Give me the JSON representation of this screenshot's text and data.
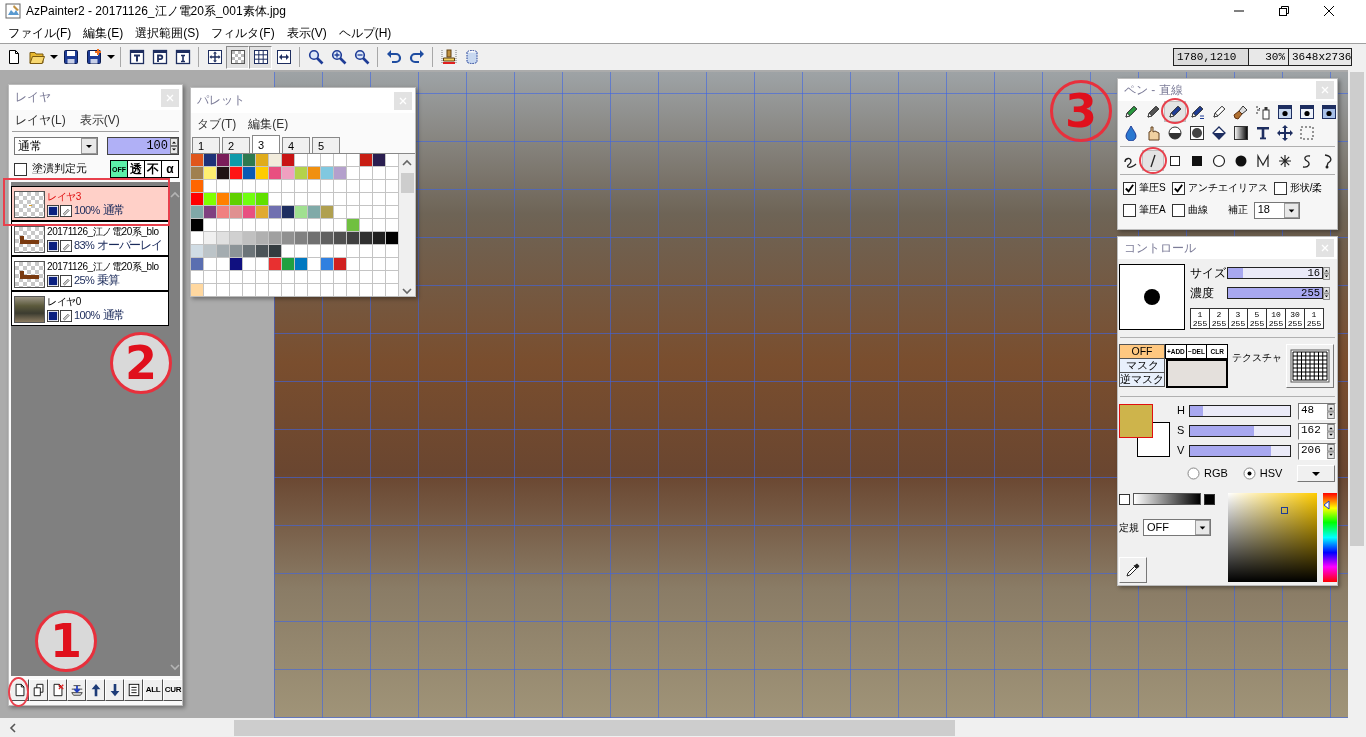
{
  "window": {
    "title": "AzPainter2 - 20171126_江ノ電20系_001素体.jpg"
  },
  "menu": [
    "ファイル(F)",
    "編集(E)",
    "選択範囲(S)",
    "フィルタ(F)",
    "表示(V)",
    "ヘルプ(H)"
  ],
  "toolbar": [
    {
      "pressed": false
    },
    {
      "pressed": false
    },
    {
      "pressed": false
    },
    {
      "pressed": false
    },
    {
      "pressed": false
    },
    {
      "pressed": false
    },
    {
      "pressed": false
    },
    {
      "pressed": false
    },
    {
      "pressed": false
    },
    {
      "pressed": false
    },
    {
      "pressed": true
    },
    {
      "pressed": true
    },
    {
      "pressed": false
    },
    {
      "pressed": false
    },
    {
      "pressed": false
    },
    {
      "pressed": false
    },
    {
      "pressed": false
    },
    {
      "pressed": false
    },
    {
      "pressed": false
    },
    {
      "pressed": false
    }
  ],
  "status": [
    "1780,1210",
    "30%",
    "3648x2736"
  ],
  "layer_panel": {
    "title": "レイヤ",
    "menu": [
      "レイヤ(L)",
      "表示(V)"
    ],
    "blend_mode": "通常",
    "opacity": "100",
    "fill_source": {
      "label": "塗潰判定元",
      "checked": false
    },
    "mode_buttons": [
      {
        "label": "OFF",
        "selected": true
      },
      {
        "label": "透",
        "selected": false
      },
      {
        "label": "不",
        "selected": false
      },
      {
        "label": "α",
        "selected": false
      }
    ],
    "layers": [
      {
        "name": "レイヤ3",
        "opacity": "100%",
        "mode": "通常",
        "kind": "empty",
        "visible": true,
        "selected": true
      },
      {
        "name": "20171126_江ノ電20系_blo",
        "opacity": "83%",
        "mode": "オーバーレイ",
        "kind": "drawing",
        "visible": true,
        "selected": false
      },
      {
        "name": "20171126_江ノ電20系_blo",
        "opacity": "25%",
        "mode": "乗算",
        "kind": "drawing",
        "visible": true,
        "selected": false
      },
      {
        "name": "レイヤ0",
        "opacity": "100%",
        "mode": "通常",
        "kind": "photo",
        "visible": true,
        "selected": false
      }
    ],
    "footer_buttons": [
      "ALL",
      "CUR"
    ]
  },
  "palette_panel": {
    "title": "パレット",
    "menu": [
      "タブ(T)",
      "編集(E)"
    ],
    "tabs": [
      {
        "label": "1",
        "selected": false
      },
      {
        "label": "2",
        "selected": false
      },
      {
        "label": "3",
        "selected": true
      },
      {
        "label": "4",
        "selected": false
      },
      {
        "label": "5",
        "selected": false
      }
    ],
    "rows": [
      {
        "swatches": [
          {
            "color": "#e0561c"
          },
          {
            "color": "#1e3278"
          },
          {
            "color": "#7a1e5a"
          },
          {
            "color": "#0e9aaa"
          },
          {
            "color": "#2e7a50"
          },
          {
            "color": "#e0ac1c"
          },
          {
            "color": "#f2ecdc"
          },
          {
            "color": "#c81414"
          },
          {
            "color": "#ffffff"
          },
          {
            "color": "#ffffff"
          },
          {
            "color": "#ffffff"
          },
          {
            "color": "#ffffff"
          },
          {
            "color": "#ffffff"
          },
          {
            "color": "#c81e14"
          },
          {
            "color": "#2a1e50"
          },
          {
            "color": "#ffffff"
          }
        ]
      },
      {
        "swatches": [
          {
            "color": "#a08050"
          },
          {
            "color": "#fff070"
          },
          {
            "color": "#201414"
          },
          {
            "color": "#ff1414"
          },
          {
            "color": "#0a5ab4"
          },
          {
            "color": "#ffcc00"
          },
          {
            "color": "#e85080"
          },
          {
            "color": "#f0a0c0"
          },
          {
            "color": "#b4d24a"
          },
          {
            "color": "#f09010"
          },
          {
            "color": "#80c8e0"
          },
          {
            "color": "#b4a0cc"
          },
          {
            "color": "#ffffff"
          },
          {
            "color": "#ffffff"
          },
          {
            "color": "#ffffff"
          },
          {
            "color": "#ffffff"
          }
        ]
      },
      {
        "swatches": [
          {
            "color": "#ff6600"
          },
          {
            "color": "#ffffff"
          },
          {
            "color": "#ffffff"
          },
          {
            "color": "#ffffff"
          },
          {
            "color": "#ffffff"
          },
          {
            "color": "#ffffff"
          },
          {
            "color": "#ffffff"
          },
          {
            "color": "#ffffff"
          },
          {
            "color": "#ffffff"
          },
          {
            "color": "#ffffff"
          },
          {
            "color": "#ffffff"
          },
          {
            "color": "#ffffff"
          },
          {
            "color": "#ffffff"
          },
          {
            "color": "#ffffff"
          },
          {
            "color": "#ffffff"
          },
          {
            "color": "#ffffff"
          }
        ]
      },
      {
        "swatches": [
          {
            "color": "#ff0000"
          },
          {
            "color": "#80ff00"
          },
          {
            "color": "#ff8000"
          },
          {
            "color": "#60d000"
          },
          {
            "color": "#70ff10"
          },
          {
            "color": "#60e000"
          },
          {
            "color": "#ffffff"
          },
          {
            "color": "#ffffff"
          },
          {
            "color": "#ffffff"
          },
          {
            "color": "#ffffff"
          },
          {
            "color": "#ffffff"
          },
          {
            "color": "#ffffff"
          },
          {
            "color": "#ffffff"
          },
          {
            "color": "#ffffff"
          },
          {
            "color": "#ffffff"
          },
          {
            "color": "#ffffff"
          }
        ]
      },
      {
        "swatches": [
          {
            "color": "#80a8a8"
          },
          {
            "color": "#804080"
          },
          {
            "color": "#f08080"
          },
          {
            "color": "#e09090"
          },
          {
            "color": "#e85080"
          },
          {
            "color": "#e0aa30"
          },
          {
            "color": "#7070b0"
          },
          {
            "color": "#1e2e60"
          },
          {
            "color": "#a0e090"
          },
          {
            "color": "#80aaa8"
          },
          {
            "color": "#b0a050"
          },
          {
            "color": "#ffffff"
          },
          {
            "color": "#ffffff"
          },
          {
            "color": "#ffffff"
          },
          {
            "color": "#ffffff"
          },
          {
            "color": "#ffffff"
          }
        ]
      },
      {
        "swatches": [
          {
            "color": "#000000"
          },
          {
            "color": "#ffffff"
          },
          {
            "color": "#ffffff"
          },
          {
            "color": "#ffffff"
          },
          {
            "color": "#ffffff"
          },
          {
            "color": "#ffffff"
          },
          {
            "color": "#ffffff"
          },
          {
            "color": "#ffffff"
          },
          {
            "color": "#ffffff"
          },
          {
            "color": "#ffffff"
          },
          {
            "color": "#ffffff"
          },
          {
            "color": "#ffffff"
          },
          {
            "color": "#70c040"
          },
          {
            "color": "#ffffff"
          },
          {
            "color": "#ffffff"
          },
          {
            "color": "#ffffff"
          }
        ]
      },
      {
        "swatches": [
          {
            "color": "#ffffff"
          },
          {
            "color": "#f0f0f0"
          },
          {
            "color": "#e0e0e0"
          },
          {
            "color": "#d0d0d0"
          },
          {
            "color": "#c0c0c0"
          },
          {
            "color": "#b0b0b0"
          },
          {
            "color": "#a0a0a0"
          },
          {
            "color": "#909090"
          },
          {
            "color": "#808080"
          },
          {
            "color": "#707070"
          },
          {
            "color": "#606060"
          },
          {
            "color": "#505050"
          },
          {
            "color": "#404040"
          },
          {
            "color": "#303030"
          },
          {
            "color": "#202020"
          },
          {
            "color": "#000000"
          }
        ]
      },
      {
        "swatches": [
          {
            "color": "#d0dce4"
          },
          {
            "color": "#bcc4c8"
          },
          {
            "color": "#a4acb0"
          },
          {
            "color": "#8c9498"
          },
          {
            "color": "#6c7478"
          },
          {
            "color": "#4c5458"
          },
          {
            "color": "#343c40"
          },
          {
            "color": "#ffffff"
          },
          {
            "color": "#ffffff"
          },
          {
            "color": "#ffffff"
          },
          {
            "color": "#ffffff"
          },
          {
            "color": "#ffffff"
          },
          {
            "color": "#ffffff"
          },
          {
            "color": "#ffffff"
          },
          {
            "color": "#ffffff"
          },
          {
            "color": "#ffffff"
          }
        ]
      },
      {
        "swatches": [
          {
            "color": "#5a6eb0"
          },
          {
            "color": "#ffffff"
          },
          {
            "color": "#ffffff"
          },
          {
            "color": "#101080"
          },
          {
            "color": "#ffffff"
          },
          {
            "color": "#ffffff"
          },
          {
            "color": "#e83030"
          },
          {
            "color": "#20a040"
          },
          {
            "color": "#0078c0"
          },
          {
            "color": "#ffffff"
          },
          {
            "color": "#3080e0"
          },
          {
            "color": "#d02020"
          },
          {
            "color": "#ffffff"
          },
          {
            "color": "#ffffff"
          },
          {
            "color": "#ffffff"
          },
          {
            "color": "#ffffff"
          }
        ]
      },
      {
        "swatches": [
          {
            "color": "#ffffff"
          },
          {
            "color": "#ffffff"
          },
          {
            "color": "#ffffff"
          },
          {
            "color": "#ffffff"
          },
          {
            "color": "#ffffff"
          },
          {
            "color": "#ffffff"
          },
          {
            "color": "#ffffff"
          },
          {
            "color": "#ffffff"
          },
          {
            "color": "#ffffff"
          },
          {
            "color": "#ffffff"
          },
          {
            "color": "#ffffff"
          },
          {
            "color": "#ffffff"
          },
          {
            "color": "#ffffff"
          },
          {
            "color": "#ffffff"
          },
          {
            "color": "#ffffff"
          },
          {
            "color": "#ffffff"
          }
        ]
      },
      {
        "swatches": [
          {
            "color": "#ffd8a0"
          },
          {
            "color": "#ffffff"
          },
          {
            "color": "#ffffff"
          },
          {
            "color": "#ffffff"
          },
          {
            "color": "#ffffff"
          },
          {
            "color": "#ffffff"
          },
          {
            "color": "#ffffff"
          },
          {
            "color": "#ffffff"
          },
          {
            "color": "#ffffff"
          },
          {
            "color": "#ffffff"
          },
          {
            "color": "#ffffff"
          },
          {
            "color": "#ffffff"
          },
          {
            "color": "#ffffff"
          },
          {
            "color": "#ffffff"
          },
          {
            "color": "#ffffff"
          },
          {
            "color": "#ffffff"
          }
        ]
      }
    ]
  },
  "tool_panel": {
    "title": "ペン - 直線",
    "tools": [
      {
        "selected": false
      },
      {
        "selected": false
      },
      {
        "selected": true
      },
      {
        "selected": false
      },
      {
        "selected": false
      },
      {
        "selected": false
      },
      {
        "selected": false
      },
      {
        "selected": false
      },
      {
        "selected": false
      },
      {
        "selected": false
      },
      {
        "selected": false
      },
      {
        "selected": false
      },
      {
        "selected": false
      },
      {
        "selected": false
      },
      {
        "selected": false
      },
      {
        "selected": false
      },
      {
        "selected": false
      },
      {
        "selected": false
      },
      {
        "selected": false
      }
    ],
    "shapes": [
      {
        "selected": false
      },
      {
        "selected": true
      },
      {
        "selected": false
      },
      {
        "selected": false
      },
      {
        "selected": false
      },
      {
        "selected": false
      },
      {
        "selected": false
      },
      {
        "selected": false
      },
      {
        "selected": false
      },
      {
        "selected": false
      }
    ],
    "options": [
      {
        "label": "筆圧S",
        "checked": true
      },
      {
        "label": "アンチエイリアス",
        "checked": true
      },
      {
        "label": "形状/柔",
        "checked": false
      },
      {
        "label": "筆圧A",
        "checked": false
      },
      {
        "label": "曲線",
        "checked": false
      }
    ],
    "correction": {
      "label": "補正",
      "value": "18"
    }
  },
  "control_panel": {
    "title": "コントロール",
    "size": {
      "label": "サイズ",
      "value": "16",
      "level": 0.16
    },
    "density": {
      "label": "濃度",
      "value": "255",
      "level": 1
    },
    "presets": [
      {
        "numerator": "1",
        "denominator": "255"
      },
      {
        "numerator": "2",
        "denominator": "255"
      },
      {
        "numerator": "3",
        "denominator": "255"
      },
      {
        "numerator": "5",
        "denominator": "255"
      },
      {
        "numerator": "10",
        "denominator": "255"
      },
      {
        "numerator": "30",
        "denominator": "255"
      },
      {
        "numerator": "1",
        "denominator": "255"
      }
    ],
    "mask_modes": [
      {
        "label": "OFF",
        "selected": true
      },
      {
        "label": "マスク",
        "selected": false
      },
      {
        "label": "逆マスク",
        "selected": false
      }
    ],
    "mask_buttons": [
      "+ADD",
      "−DEL",
      "CLR"
    ],
    "mask_swatch": {
      "color": "#e4e0dc"
    },
    "texture_label": "テクスチャ",
    "color_swatches": [
      {
        "color": "#ceb44b"
      },
      {
        "color": "#ffffff"
      }
    ],
    "channels": [
      {
        "label": "H",
        "value": "48",
        "level": 0.133
      },
      {
        "label": "S",
        "value": "162",
        "level": 0.635
      },
      {
        "label": "V",
        "value": "206",
        "level": 0.808
      }
    ],
    "models": [
      {
        "label": "RGB",
        "selected": false
      },
      {
        "label": "HSV",
        "selected": true
      }
    ],
    "ruler": {
      "label": "定規",
      "value": "OFF"
    }
  },
  "annotations": [
    {
      "label": "1"
    },
    {
      "label": "2"
    },
    {
      "label": "3"
    }
  ]
}
